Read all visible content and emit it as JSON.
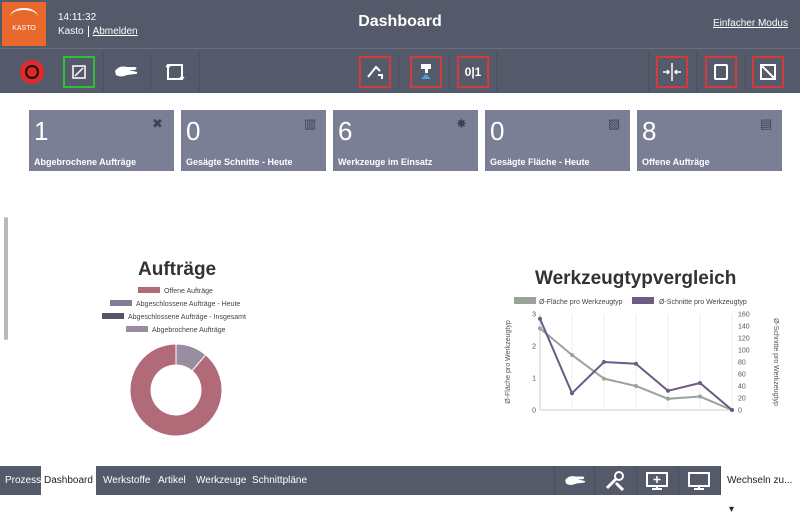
{
  "header": {
    "logo_text": "KASTO",
    "time": "14:11:32",
    "user": "Kasto",
    "logout": "Abmelden",
    "title": "Dashboard",
    "mode_link": "Einfacher Modus"
  },
  "toolbar": {
    "left": [
      {
        "name": "stop-icon",
        "glyph": "●"
      },
      {
        "name": "edit-panel-icon",
        "glyph": "▣"
      },
      {
        "name": "hand-icon",
        "glyph": "✋"
      },
      {
        "name": "cycle-icon",
        "glyph": "⟲"
      }
    ],
    "middle": [
      {
        "name": "saw-down-icon",
        "glyph": "⤓"
      },
      {
        "name": "coolant-icon",
        "glyph": "💧"
      },
      {
        "name": "zero-one-icon",
        "glyph": "0|1"
      }
    ],
    "right": [
      {
        "name": "clamp-icon",
        "glyph": "⇥"
      },
      {
        "name": "material-icon",
        "glyph": "▢"
      },
      {
        "name": "diagonal-cut-icon",
        "glyph": "⧄"
      }
    ]
  },
  "tiles": [
    {
      "value": "1",
      "label": "Abgebrochene Aufträge",
      "icon": "broken-icon",
      "glyph": "✖"
    },
    {
      "value": "0",
      "label": "Gesägte Schnitte - Heute",
      "icon": "cuts-icon",
      "glyph": "▥"
    },
    {
      "value": "6",
      "label": "Werkzeuge im Einsatz",
      "icon": "gear-icon",
      "glyph": "✸"
    },
    {
      "value": "0",
      "label": "Gesägte Fläche - Heute",
      "icon": "area-icon",
      "glyph": "▨"
    },
    {
      "value": "8",
      "label": "Offene Aufträge",
      "icon": "clipboard-icon",
      "glyph": "▤"
    }
  ],
  "colors": {
    "topbar": "#555a6b",
    "tile": "#7b7f95",
    "donut_open": "#b16a77",
    "donut_aborted": "#998da1",
    "done_today": "#7d7f95",
    "done_total": "#545567",
    "series_area": "#9aa39a",
    "series_cuts": "#6b5b85"
  },
  "chart_data": [
    {
      "type": "pie",
      "title": "Aufträge",
      "legend": [
        "Offene Aufträge",
        "Abgeschlossene Aufträge - Heute",
        "Abgeschlossene Aufträge - Insgesamt",
        "Abgebrochene Aufträge"
      ],
      "values": [
        8,
        0,
        0,
        1
      ],
      "legend_placement": "top"
    },
    {
      "type": "line",
      "title": "Werkzeugtypvergleich",
      "ylabel": "Ø-Fläche pro Werkzeugtyp",
      "y2label": "Ø-Schnitte pro Werkzeugtyp",
      "ylim": [
        0,
        3
      ],
      "y2lim": [
        0,
        160
      ],
      "yticks": [
        "0",
        "0.5",
        "1",
        "1.5",
        "2",
        "2.5",
        "3"
      ],
      "y2ticks": [
        "0",
        "20",
        "40",
        "60",
        "80",
        "100",
        "120",
        "140",
        "160"
      ],
      "series": [
        {
          "name": "Ø-Fläche pro Werkzeugtyp",
          "axis": "left",
          "values": [
            2.55,
            1.72,
            0.98,
            0.75,
            0.35,
            0.42,
            0
          ]
        },
        {
          "name": "Ø-Schnitte pro Werkzeugtyp",
          "axis": "right",
          "values": [
            152,
            28,
            80,
            77,
            32,
            45,
            0
          ]
        }
      ],
      "legend_placement": "top"
    }
  ],
  "bottom": {
    "tabs": [
      "Prozess",
      "Dashboard",
      "Werkstoffe",
      "Artikel",
      "Werkzeuge",
      "Schnittpläne"
    ],
    "active_tab": "Dashboard",
    "icons": [
      {
        "name": "hand-icon"
      },
      {
        "name": "tools-icon"
      },
      {
        "name": "monitor-add-icon"
      },
      {
        "name": "monitor-icon"
      }
    ],
    "switch_label": "Wechseln zu...",
    "switch_caret": "▾"
  }
}
